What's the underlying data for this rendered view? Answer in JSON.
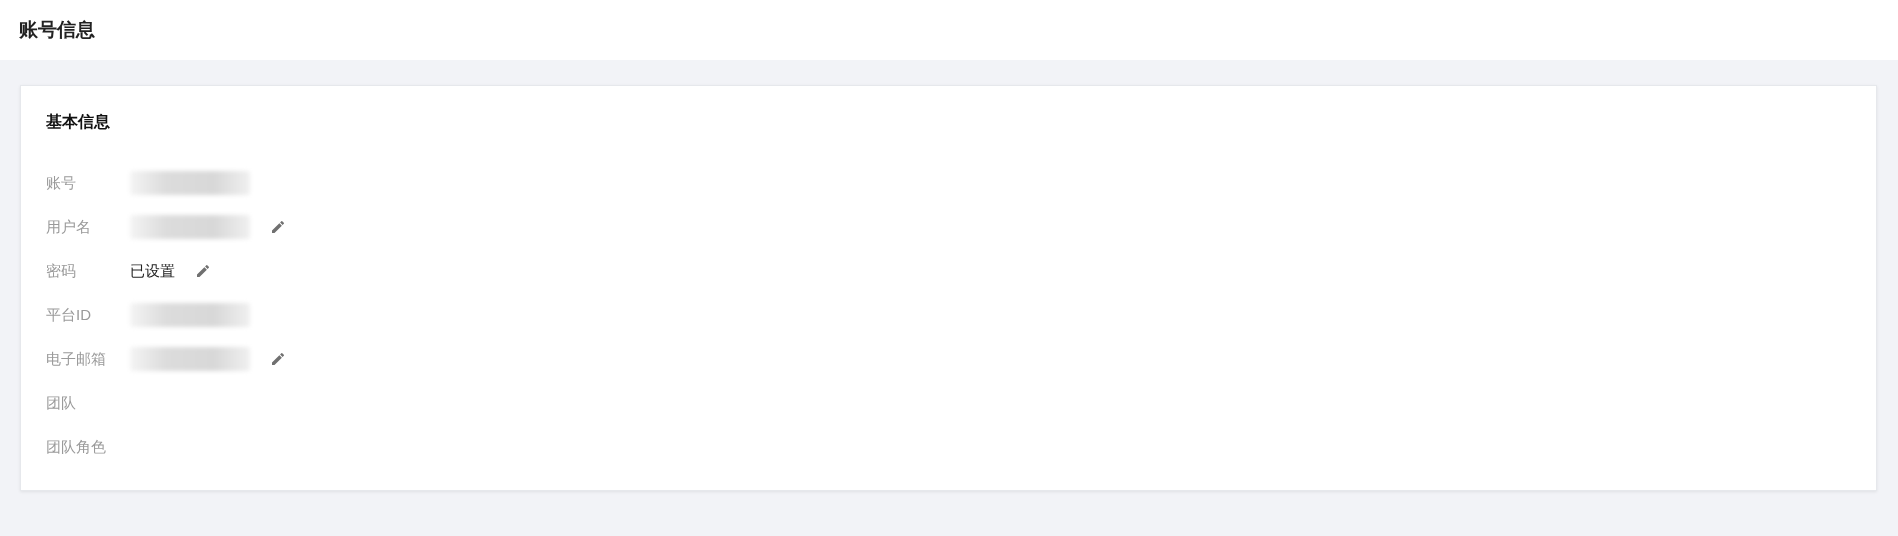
{
  "page_title": "账号信息",
  "card": {
    "title": "基本信息",
    "fields": [
      {
        "label": "账号",
        "kind": "redacted",
        "editable": false
      },
      {
        "label": "用户名",
        "kind": "redacted",
        "editable": true
      },
      {
        "label": "密码",
        "kind": "text",
        "value": "已设置",
        "editable": true
      },
      {
        "label": "平台ID",
        "kind": "redacted",
        "editable": false
      },
      {
        "label": "电子邮箱",
        "kind": "redacted",
        "editable": true
      },
      {
        "label": "团队",
        "kind": "empty",
        "editable": false
      },
      {
        "label": "团队角色",
        "kind": "empty",
        "editable": false
      }
    ]
  }
}
